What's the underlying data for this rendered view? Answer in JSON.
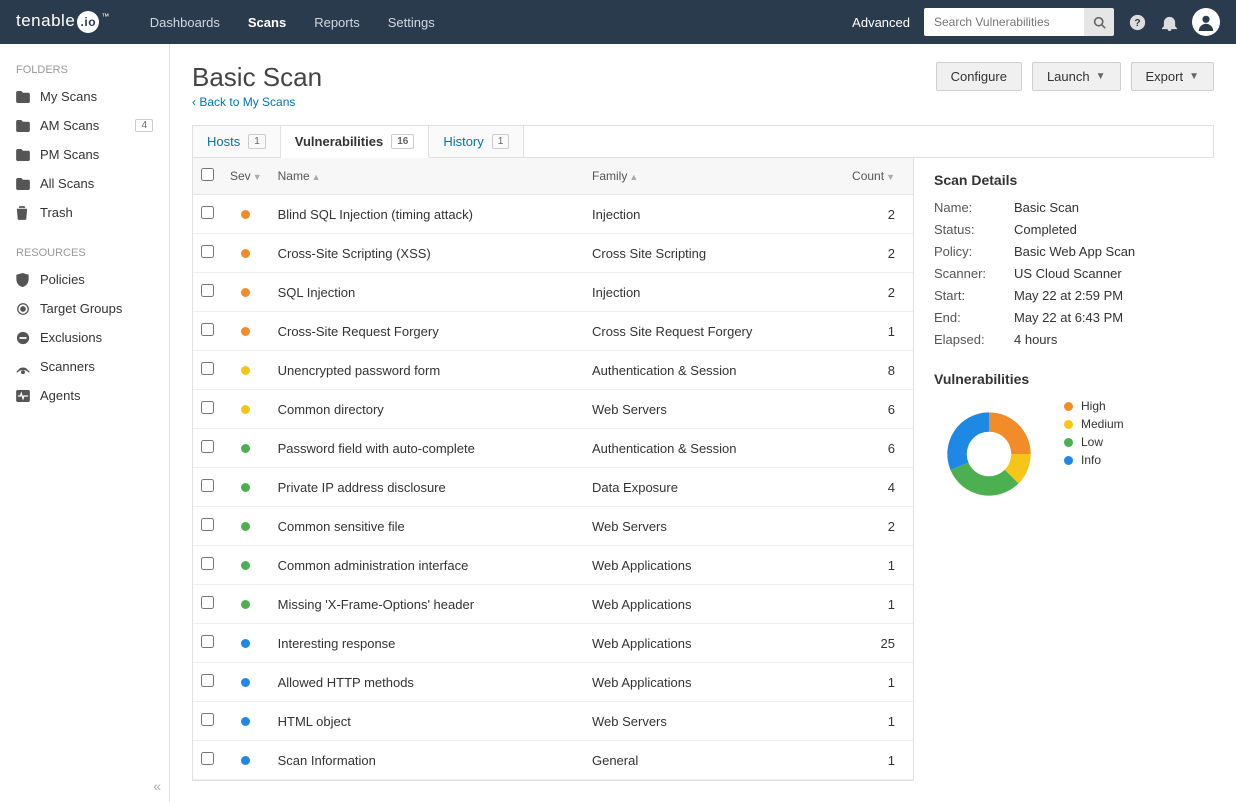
{
  "brand": {
    "name": "tenable",
    "suffix": ".io",
    "tm": "™"
  },
  "topnav": {
    "dashboards": "Dashboards",
    "scans": "Scans",
    "reports": "Reports",
    "settings": "Settings"
  },
  "topbar": {
    "advanced": "Advanced",
    "search_placeholder": "Search Vulnerabilities"
  },
  "sidebar": {
    "folders_label": "FOLDERS",
    "resources_label": "RESOURCES",
    "folders": [
      {
        "label": "My Scans",
        "icon": "folder"
      },
      {
        "label": "AM Scans",
        "icon": "folder",
        "badge": "4"
      },
      {
        "label": "PM Scans",
        "icon": "folder"
      },
      {
        "label": "All Scans",
        "icon": "folder"
      },
      {
        "label": "Trash",
        "icon": "trash"
      }
    ],
    "resources": [
      {
        "label": "Policies",
        "icon": "shield"
      },
      {
        "label": "Target Groups",
        "icon": "target"
      },
      {
        "label": "Exclusions",
        "icon": "minus-circle"
      },
      {
        "label": "Scanners",
        "icon": "radar"
      },
      {
        "label": "Agents",
        "icon": "heartbeat"
      }
    ]
  },
  "page": {
    "title": "Basic Scan",
    "back": "Back to My Scans",
    "buttons": {
      "configure": "Configure",
      "launch": "Launch",
      "export": "Export"
    }
  },
  "tabs": [
    {
      "label": "Hosts",
      "count": "1"
    },
    {
      "label": "Vulnerabilities",
      "count": "16",
      "active": true
    },
    {
      "label": "History",
      "count": "1"
    }
  ],
  "columns": {
    "sev": "Sev",
    "name": "Name",
    "family": "Family",
    "count": "Count"
  },
  "sev_colors": {
    "high": "#f28c28",
    "medium": "#f5c518",
    "low": "#4caf50",
    "info": "#1e88e5"
  },
  "rows": [
    {
      "sev": "high",
      "name": "Blind SQL Injection (timing attack)",
      "family": "Injection",
      "count": "2"
    },
    {
      "sev": "high",
      "name": "Cross-Site Scripting (XSS)",
      "family": "Cross Site Scripting",
      "count": "2"
    },
    {
      "sev": "high",
      "name": "SQL Injection",
      "family": "Injection",
      "count": "2"
    },
    {
      "sev": "high",
      "name": "Cross-Site Request Forgery",
      "family": "Cross Site Request Forgery",
      "count": "1"
    },
    {
      "sev": "medium",
      "name": "Unencrypted password form",
      "family": "Authentication & Session",
      "count": "8"
    },
    {
      "sev": "medium",
      "name": "Common directory",
      "family": "Web Servers",
      "count": "6"
    },
    {
      "sev": "low",
      "name": "Password field with auto-complete",
      "family": "Authentication & Session",
      "count": "6"
    },
    {
      "sev": "low",
      "name": "Private IP address disclosure",
      "family": "Data Exposure",
      "count": "4"
    },
    {
      "sev": "low",
      "name": "Common sensitive file",
      "family": "Web Servers",
      "count": "2"
    },
    {
      "sev": "low",
      "name": "Common administration interface",
      "family": "Web Applications",
      "count": "1"
    },
    {
      "sev": "low",
      "name": "Missing 'X-Frame-Options' header",
      "family": "Web Applications",
      "count": "1"
    },
    {
      "sev": "info",
      "name": "Interesting response",
      "family": "Web Applications",
      "count": "25"
    },
    {
      "sev": "info",
      "name": "Allowed HTTP methods",
      "family": "Web Applications",
      "count": "1"
    },
    {
      "sev": "info",
      "name": "HTML object",
      "family": "Web Servers",
      "count": "1"
    },
    {
      "sev": "info",
      "name": "Scan Information",
      "family": "General",
      "count": "1"
    }
  ],
  "details": {
    "header": "Scan Details",
    "fields": {
      "name_l": "Name:",
      "name_v": "Basic Scan",
      "status_l": "Status:",
      "status_v": "Completed",
      "policy_l": "Policy:",
      "policy_v": "Basic Web App Scan",
      "scanner_l": "Scanner:",
      "scanner_v": "US Cloud Scanner",
      "start_l": "Start:",
      "start_v": "May 22 at 2:59 PM",
      "end_l": "End:",
      "end_v": "May 22 at 6:43 PM",
      "elapsed_l": "Elapsed:",
      "elapsed_v": "4 hours"
    },
    "vuln_header": "Vulnerabilities",
    "legend": {
      "high": "High",
      "medium": "Medium",
      "low": "Low",
      "info": "Info"
    }
  },
  "chart_data": {
    "type": "pie",
    "title": "Vulnerabilities",
    "categories": [
      "High",
      "Medium",
      "Low",
      "Info"
    ],
    "values": [
      4,
      2,
      5,
      5
    ],
    "colors": [
      "#f28c28",
      "#f5c518",
      "#4caf50",
      "#1e88e5"
    ]
  }
}
